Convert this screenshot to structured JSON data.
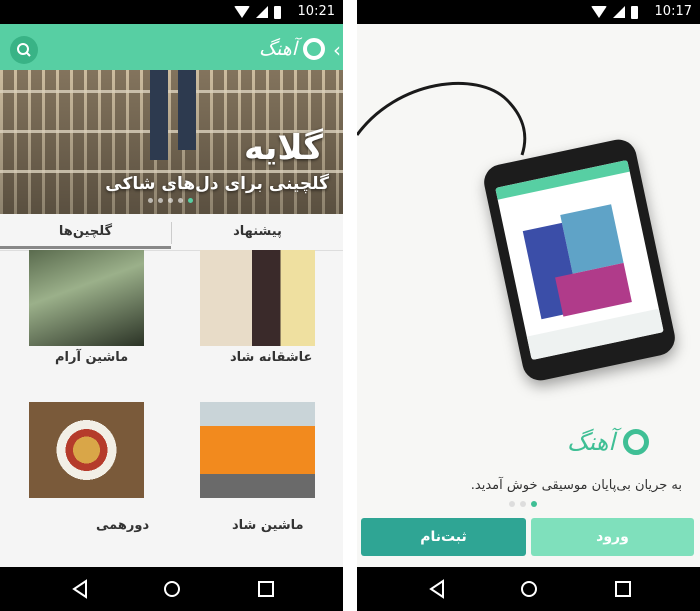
{
  "status_left": {
    "time": "10:21"
  },
  "status_right": {
    "time": "10:17"
  },
  "left": {
    "logo_text": "آهنگ",
    "hero": {
      "title": "گلایه",
      "subtitle": "گلچینی برای دل‌های شاکی",
      "slide_count": 5,
      "active_slide": 5
    },
    "tabs": [
      {
        "label": "گلچین‌ها",
        "active": true
      },
      {
        "label": "پیشنهاد",
        "active": false
      }
    ],
    "cards": [
      {
        "label": "ماشین آرام",
        "icon": "rainy-car-photo"
      },
      {
        "label": "عاشقانه شاد",
        "icon": "couple-photo"
      },
      {
        "label": "دورهمی",
        "icon": "party-food-photo"
      },
      {
        "label": "ماشین شاد",
        "icon": "orange-taxi-photo"
      }
    ]
  },
  "right": {
    "logo_text": "آهنگ",
    "welcome_text": "به جریان بی‌پایان موسیقی خوش آمدید.",
    "pager": {
      "count": 3,
      "active": 3
    },
    "buttons": {
      "register": "ثبت‌نام",
      "login": "ورود"
    }
  },
  "colors": {
    "accent": "#57cfa3",
    "accent_dark": "#2fa594",
    "accent_light": "#7fe0bc"
  }
}
